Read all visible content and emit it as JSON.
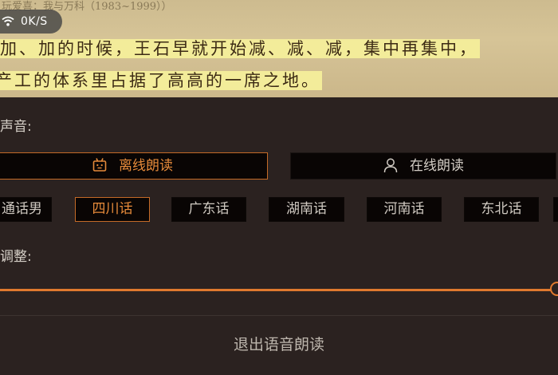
{
  "reader": {
    "book_title": "玩爱喜：我与万科（1983~1999））",
    "lines": [
      "加、加的时候，王石早就开始减、减、减，集中再集中，",
      "产工的体系里占据了高高的一席之地。"
    ]
  },
  "status": {
    "network_speed": "0K/S",
    "icon": "wifi-icon"
  },
  "panel": {
    "voice_label": "声音:",
    "modes": [
      {
        "label": "离线朗读",
        "icon": "robot-icon",
        "selected": true
      },
      {
        "label": "在线朗读",
        "icon": "person-icon",
        "selected": false
      }
    ],
    "dialects": [
      "通话男",
      "四川话",
      "广东话",
      "湖南话",
      "河南话",
      "东北话",
      ""
    ],
    "selected_dialect": "四川话",
    "speed_label": "调整:",
    "speed_value": 1.0,
    "exit_label": "退出语音朗读"
  },
  "colors": {
    "accent": "#e0792e",
    "highlight": "#f3ec9a",
    "panel_bg": "#2b2220",
    "button_bg": "#090504"
  }
}
